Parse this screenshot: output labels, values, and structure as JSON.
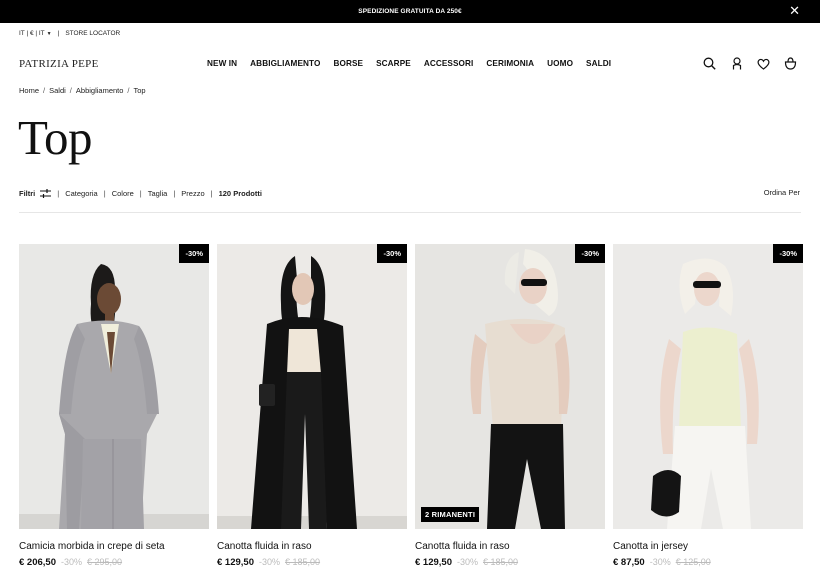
{
  "promo": {
    "text": "SPEDIZIONE GRATUITA DA 250€",
    "close": "✕"
  },
  "util": {
    "locale": "IT | € | IT",
    "store": "STORE LOCATOR"
  },
  "header": {
    "logo": "PATRIZIA PEPE",
    "nav": [
      "NEW IN",
      "ABBIGLIAMENTO",
      "BORSE",
      "SCARPE",
      "ACCESSORI",
      "CERIMONIA",
      "UOMO",
      "SALDI"
    ],
    "icons": [
      "search-icon",
      "account-icon",
      "wishlist-icon",
      "bag-icon"
    ]
  },
  "breadcrumb": [
    "Home",
    "Saldi",
    "Abbigliamento",
    "Top"
  ],
  "page_title": "Top",
  "filters": {
    "label": "Filtri",
    "items": [
      "Categoria",
      "Colore",
      "Taglia",
      "Prezzo"
    ],
    "count": "120 Prodotti",
    "sort": "Ordina Per"
  },
  "products": [
    {
      "name": "Camicia morbida in crepe di seta",
      "price": "€ 206,50",
      "discount": "-30%",
      "old_price": "€ 295,00",
      "badge": "-30%",
      "stock": ""
    },
    {
      "name": "Canotta fluida in raso",
      "price": "€ 129,50",
      "discount": "-30%",
      "old_price": "€ 185,00",
      "badge": "-30%",
      "stock": ""
    },
    {
      "name": "Canotta fluida in raso",
      "price": "€ 129,50",
      "discount": "-30%",
      "old_price": "€ 185,00",
      "badge": "-30%",
      "stock": "2 RIMANENTI"
    },
    {
      "name": "Canotta in jersey",
      "price": "€ 87,50",
      "discount": "-30%",
      "old_price": "€ 125,00",
      "badge": "-30%",
      "stock": ""
    }
  ]
}
